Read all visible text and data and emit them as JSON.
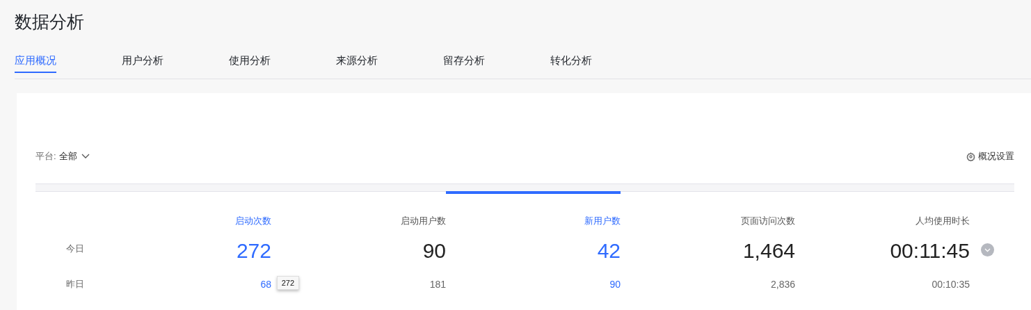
{
  "page_title": "数据分析",
  "tabs": [
    {
      "label": "应用概况",
      "selected": true
    },
    {
      "label": "用户分析",
      "selected": false
    },
    {
      "label": "使用分析",
      "selected": false
    },
    {
      "label": "来源分析",
      "selected": false
    },
    {
      "label": "留存分析",
      "selected": false
    },
    {
      "label": "转化分析",
      "selected": false
    }
  ],
  "platform_filter": {
    "label": "平台:",
    "value": "全部"
  },
  "settings_link": "概况设置",
  "row_labels": [
    "今日",
    "昨日"
  ],
  "metrics": [
    {
      "name": "启动次数",
      "highlighted": true,
      "selected": false,
      "today": "272",
      "yesterday": "68"
    },
    {
      "name": "启动用户数",
      "highlighted": false,
      "selected": false,
      "today": "90",
      "yesterday": "181"
    },
    {
      "name": "新用户数",
      "highlighted": true,
      "selected": true,
      "today": "42",
      "yesterday": "90"
    },
    {
      "name": "页面访问次数",
      "highlighted": false,
      "selected": false,
      "today": "1,464",
      "yesterday": "2,836"
    },
    {
      "name": "人均使用时长",
      "highlighted": false,
      "selected": false,
      "today": "00:11:45",
      "yesterday": "00:10:35"
    }
  ],
  "tooltip": "272"
}
